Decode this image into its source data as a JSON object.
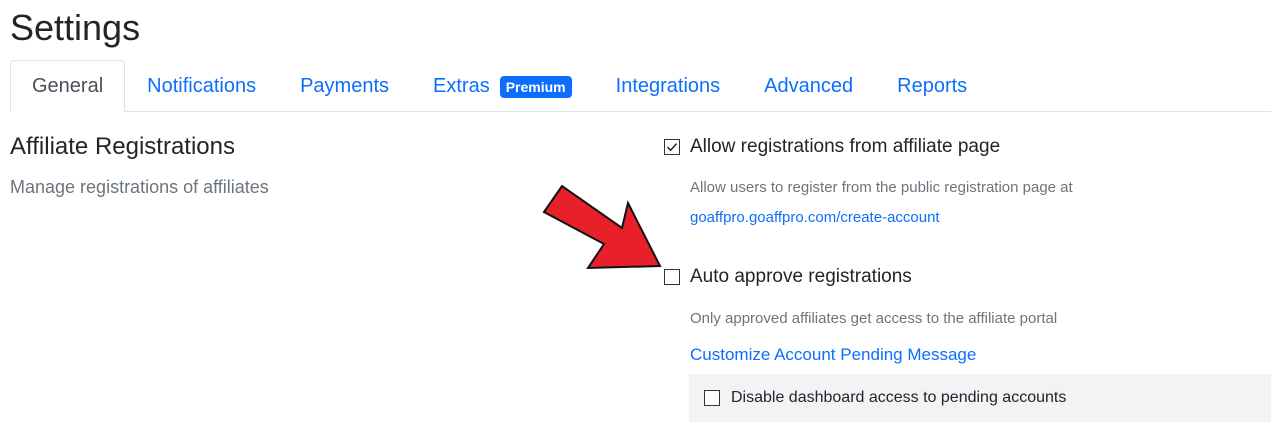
{
  "page": {
    "title": "Settings"
  },
  "tabs": [
    {
      "label": "General",
      "active": true
    },
    {
      "label": "Notifications"
    },
    {
      "label": "Payments"
    },
    {
      "label": "Extras",
      "badge": "Premium"
    },
    {
      "label": "Integrations"
    },
    {
      "label": "Advanced"
    },
    {
      "label": "Reports"
    }
  ],
  "section": {
    "title": "Affiliate Registrations",
    "description": "Manage registrations of affiliates"
  },
  "options": {
    "allow_registrations": {
      "label": "Allow registrations from affiliate page",
      "checked": true,
      "help": "Allow users to register from the public registration page at",
      "link": "goaffpro.goaffpro.com/create-account"
    },
    "auto_approve": {
      "label": "Auto approve registrations",
      "checked": false,
      "help": "Only approved affiliates get access to the affiliate portal",
      "link": "Customize Account Pending Message"
    },
    "disable_dashboard": {
      "label": "Disable dashboard access to pending accounts",
      "checked": false
    }
  },
  "annotation": {
    "arrow_color": "#e8202a",
    "icon": "red-arrow-icon"
  },
  "colors": {
    "accent": "#0d6efd",
    "muted": "#6c757d",
    "panel": "#f2f3f5"
  }
}
